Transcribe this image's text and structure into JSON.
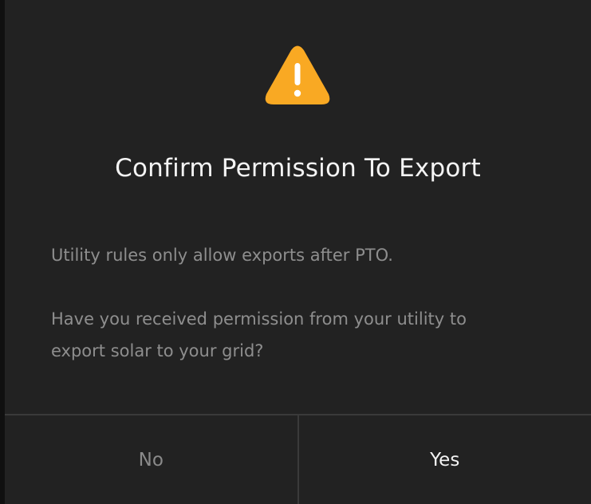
{
  "dialog": {
    "title": "Confirm Permission To Export",
    "message": "Utility rules only allow exports after PTO.",
    "question": "Have you received permission from your utility to export solar to your grid?",
    "icon": "warning-triangle-icon",
    "accent_color": "#f9a923"
  },
  "buttons": {
    "no_label": "No",
    "yes_label": "Yes"
  }
}
